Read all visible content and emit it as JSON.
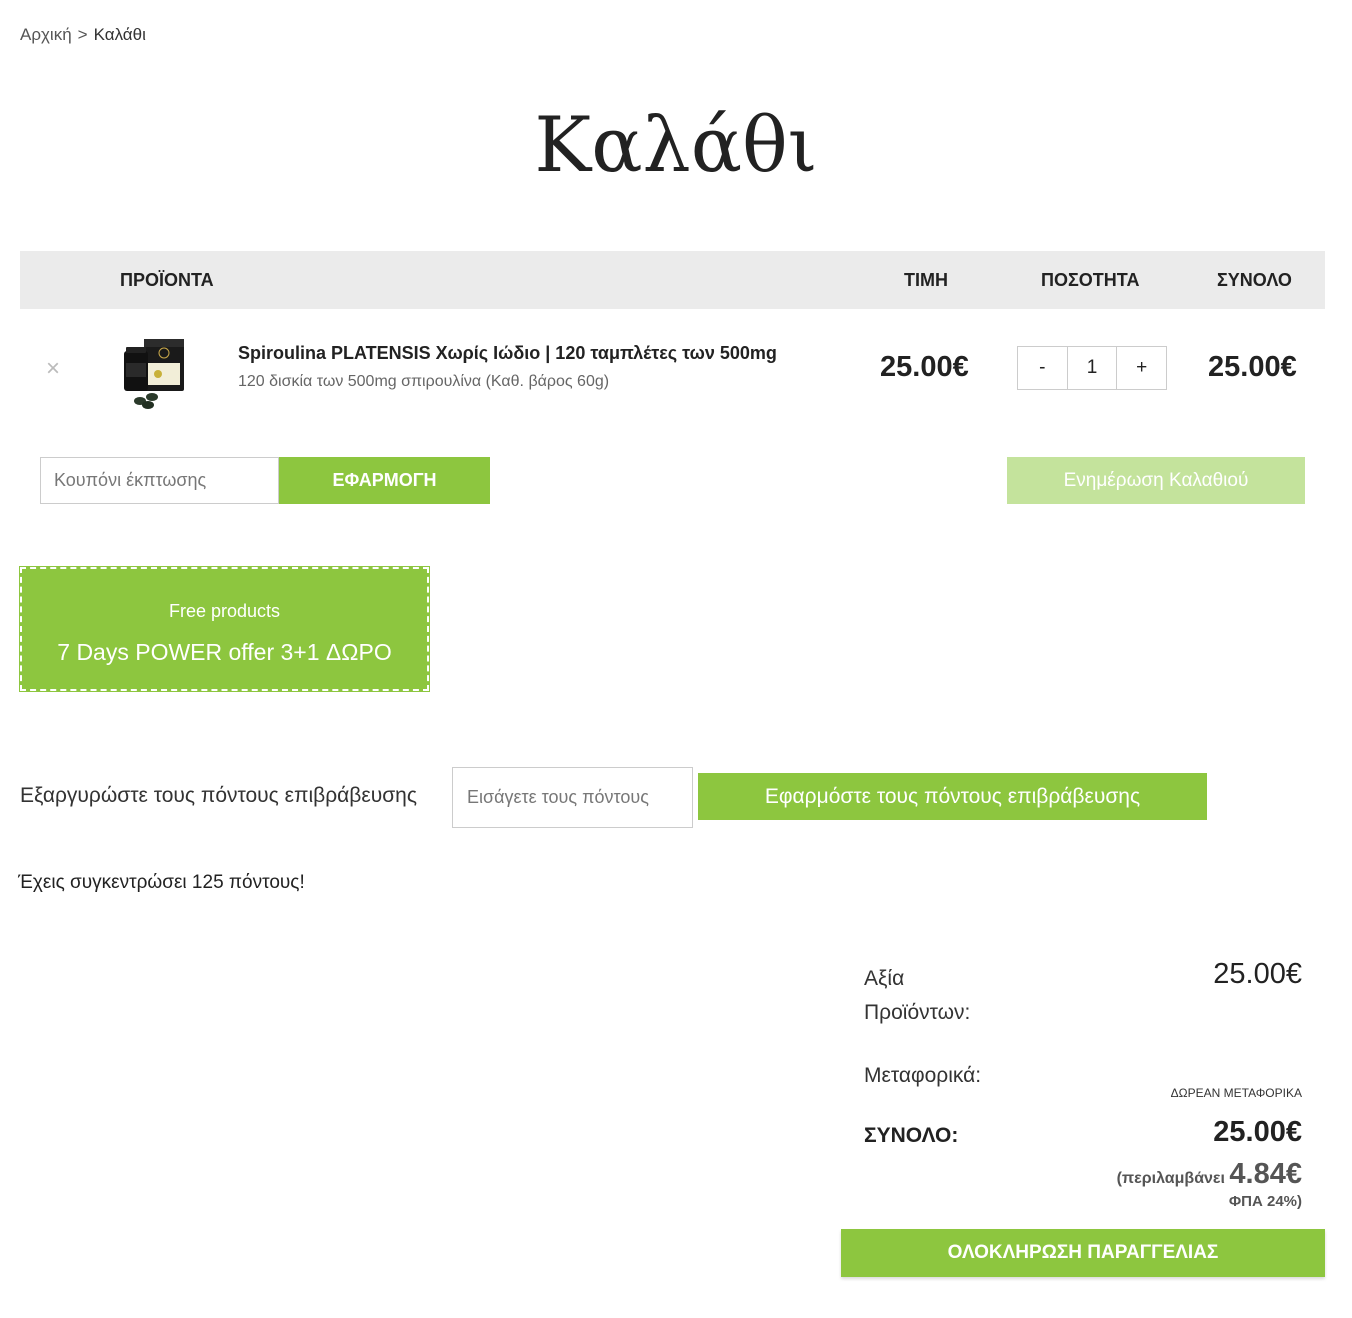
{
  "breadcrumb": {
    "home": "Αρχική",
    "separator": ">",
    "current": "Καλάθι"
  },
  "page_title": "Καλάθι",
  "table": {
    "headers": {
      "products": "ΠΡΟΪΟΝΤΑ",
      "price": "ΤΙΜΗ",
      "quantity": "ΠΟΣΟΤΗΤΑ",
      "total": "ΣΥΝΟΛΟ"
    },
    "items": [
      {
        "remove": "×",
        "name": "Spiroulina PLATENSIS Χωρίς Ιώδιο | 120 ταμπλέτες των 500mg",
        "description": "120 δισκία των 500mg σπιρουλίνα (Καθ. βάρος 60g)",
        "price": "25.00€",
        "qty_minus": "-",
        "qty": "1",
        "qty_plus": "+",
        "total": "25.00€"
      }
    ]
  },
  "coupon": {
    "placeholder": "Κουπόνι έκπτωσης",
    "apply_label": "ΕΦΑΡΜΟΓΗ"
  },
  "update_cart_label": "Ενημέρωση Καλαθιού",
  "promo": {
    "subtitle": "Free products",
    "title": "7 Days POWER offer 3+1 ΔΩΡΟ"
  },
  "rewards": {
    "label": "Εξαργυρώστε τους πόντους επιβράβευσης",
    "placeholder": "Εισάγετε τους πόντους",
    "apply_label": "Εφαρμόστε τους πόντους επιβράβευσης",
    "points_message": "Έχεις συγκεντρώσει 125 πόντους!"
  },
  "totals": {
    "subtotal_label": "Αξία Προϊόντων:",
    "subtotal_value": "25.00€",
    "shipping_label": "Μεταφορικά:",
    "shipping_value": "ΔΩΡΕΑΝ ΜΕΤΑΦΟΡΙΚΑ",
    "total_label": "ΣΥΝΟΛΟ:",
    "total_value": "25.00€",
    "vat_prefix": "(περιλαμβάνει",
    "vat_amount": "4.84€",
    "vat_rate": "ΦΠΑ 24%)"
  },
  "checkout_label": "ΟΛΟΚΛΗΡΩΣΗ ΠΑΡΑΓΓΕΛΙΑΣ",
  "colors": {
    "accent": "#8dc63f",
    "accent_light": "#c4e39c",
    "header_bg": "#ebebeb"
  }
}
